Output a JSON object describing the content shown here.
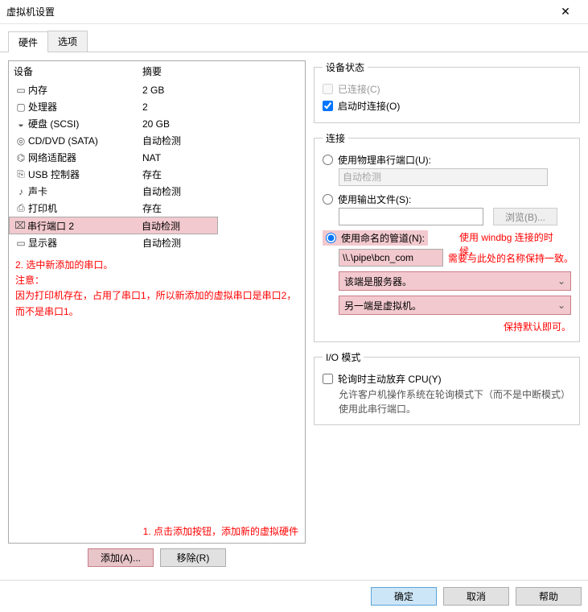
{
  "window": {
    "title": "虚拟机设置",
    "close": "✕"
  },
  "tabs": {
    "hardware": "硬件",
    "options": "选项"
  },
  "list": {
    "hdr_device": "设备",
    "hdr_summary": "摘要",
    "rows": [
      {
        "icon": "▭",
        "name": "内存",
        "summary": "2 GB"
      },
      {
        "icon": "▢",
        "name": "处理器",
        "summary": "2"
      },
      {
        "icon": "◒",
        "name": "硬盘 (SCSI)",
        "summary": "20 GB"
      },
      {
        "icon": "◎",
        "name": "CD/DVD (SATA)",
        "summary": "自动检测"
      },
      {
        "icon": "⌬",
        "name": "网络适配器",
        "summary": "NAT"
      },
      {
        "icon": "⎘",
        "name": "USB 控制器",
        "summary": "存在"
      },
      {
        "icon": "♪",
        "name": "声卡",
        "summary": "自动检测"
      },
      {
        "icon": "⎙",
        "name": "打印机",
        "summary": "存在"
      },
      {
        "icon": "⌧",
        "name": "串行端口 2",
        "summary": "自动检测",
        "sel": true
      },
      {
        "icon": "▭",
        "name": "显示器",
        "summary": "自动检测"
      }
    ]
  },
  "ann": {
    "left1": "2. 选中新添加的串口。",
    "left2": "注意：",
    "left3": "因为打印机存在，占用了串口1，所以新添加的虚拟串口是串口2，而不是串口1。",
    "bottom": "1. 点击添加按钮，添加新的虚拟硬件",
    "r1a": "使用 windbg 连接的时候，",
    "r1b": "需要与此处的名称保持一致。",
    "r2": "保持默认即可。"
  },
  "buttons": {
    "add": "添加(A)...",
    "remove": "移除(R)",
    "ok": "确定",
    "cancel": "取消",
    "help": "帮助",
    "browse": "浏览(B)..."
  },
  "status": {
    "legend": "设备状态",
    "connected": "已连接(C)",
    "connect_at_poweron": "启动时连接(O)"
  },
  "conn": {
    "legend": "连接",
    "use_physical": "使用物理串行端口(U):",
    "auto_detect": "自动检测",
    "use_outfile": "使用输出文件(S):",
    "use_named_pipe": "使用命名的管道(N):",
    "pipe_value": "\\\\.\\pipe\\bcn_com",
    "end_server": "该端是服务器。",
    "other_end_vm": "另一端是虚拟机。"
  },
  "io": {
    "legend": "I/O 模式",
    "yield_cpu": "轮询时主动放弃 CPU(Y)",
    "desc": "允许客户机操作系统在轮询模式下（而不是中断模式）使用此串行端口。"
  }
}
